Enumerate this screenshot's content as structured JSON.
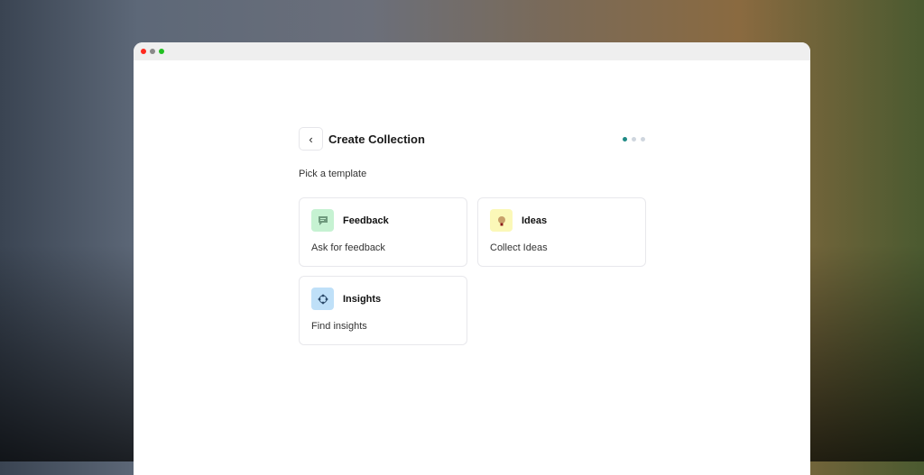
{
  "window": {
    "controls": {
      "close": "#ff2a1f",
      "minimize": "#8a8a8a",
      "maximize": "#22c022"
    }
  },
  "header": {
    "title": "Create Collection",
    "back_icon": "chevron-left-icon",
    "steps_total": 3,
    "step_current": 1
  },
  "subtitle": "Pick a template",
  "templates": [
    {
      "name": "Feedback",
      "description": "Ask for feedback",
      "icon": "message-icon",
      "icon_bg": "#c6f2d2"
    },
    {
      "name": "Ideas",
      "description": "Collect Ideas",
      "icon": "lightbulb-icon",
      "icon_bg": "#fbf8b8"
    },
    {
      "name": "Insights",
      "description": "Find insights",
      "icon": "nodes-icon",
      "icon_bg": "#bfe0f8"
    }
  ]
}
